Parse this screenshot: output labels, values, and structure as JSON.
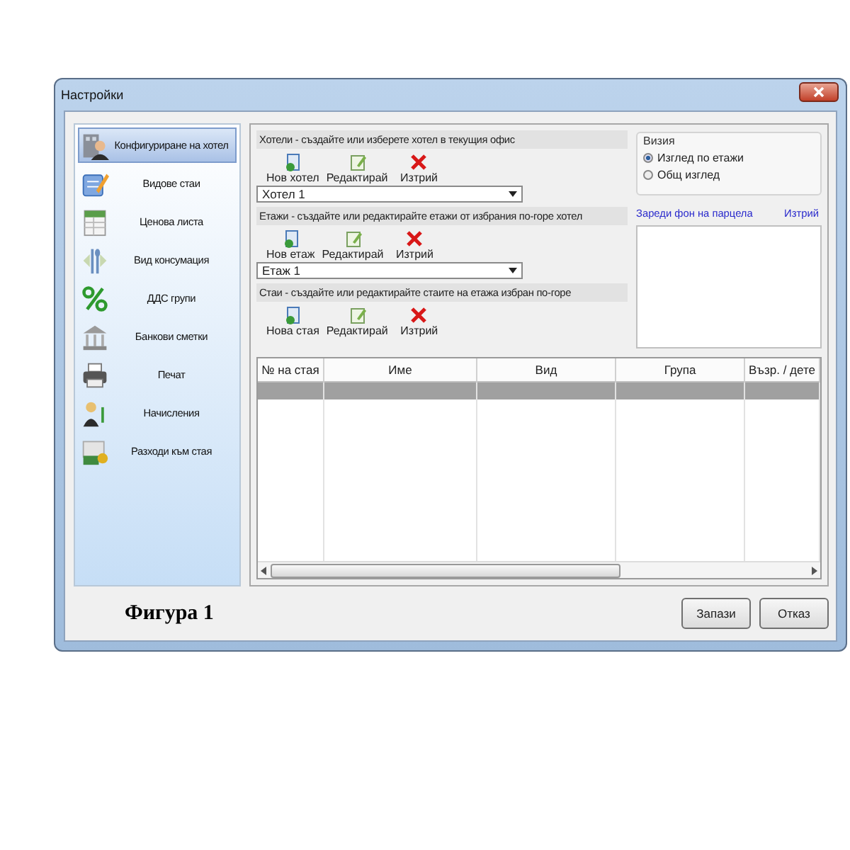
{
  "window": {
    "title": "Настройки"
  },
  "sidebar": {
    "items": [
      {
        "label": "Конфигуриране на хотел",
        "kind": "hotel",
        "selected": true
      },
      {
        "label": "Видове стаи",
        "kind": "notepad",
        "selected": false
      },
      {
        "label": "Ценова листа",
        "kind": "sheet",
        "selected": false
      },
      {
        "label": "Вид консумация",
        "kind": "cutlery",
        "selected": false
      },
      {
        "label": "ДДС групи",
        "kind": "percent",
        "selected": false
      },
      {
        "label": "Банкови сметки",
        "kind": "bank",
        "selected": false
      },
      {
        "label": "Печат",
        "kind": "printer",
        "selected": false
      },
      {
        "label": "Начисления",
        "kind": "person",
        "selected": false
      },
      {
        "label": "Разходи към стая",
        "kind": "money",
        "selected": false
      }
    ]
  },
  "sections": [
    {
      "header": "Хотели - създайте или изберете хотел в текущия офис",
      "buttons": [
        {
          "label": "Нов хотел",
          "kind": "new"
        },
        {
          "label": "Редактирай",
          "kind": "edit"
        },
        {
          "label": "Изтрий",
          "kind": "delete"
        }
      ],
      "dropdown": {
        "value": "Хотел 1"
      }
    },
    {
      "header": "Етажи - създайте или редактирайте етажи от избрания по-горе хотел",
      "buttons": [
        {
          "label": "Нов етаж",
          "kind": "new"
        },
        {
          "label": "Редактирай",
          "kind": "edit"
        },
        {
          "label": "Изтрий",
          "kind": "delete"
        }
      ],
      "dropdown": {
        "value": "Етаж 1"
      }
    },
    {
      "header": "Стаи - създайте или редактирайте стаите на етажа избран по-горе",
      "buttons": [
        {
          "label": "Нова стая",
          "kind": "new"
        },
        {
          "label": "Редактирай",
          "kind": "edit"
        },
        {
          "label": "Изтрий",
          "kind": "delete"
        }
      ]
    }
  ],
  "view": {
    "title": "Визия",
    "options": [
      {
        "label": "Изглед по етажи",
        "selected": true
      },
      {
        "label": "Общ изглед",
        "selected": false
      }
    ]
  },
  "background": {
    "load_link": "Зареди фон на парцела",
    "delete_link": "Изтрий"
  },
  "table": {
    "columns": [
      "№ на стая",
      "Име",
      "Вид",
      "Група",
      "Възр. / дете"
    ],
    "rows": [
      {
        "selected": true
      }
    ]
  },
  "caption": "Фигура 1",
  "buttons": [
    "Запази",
    "Отказ"
  ]
}
